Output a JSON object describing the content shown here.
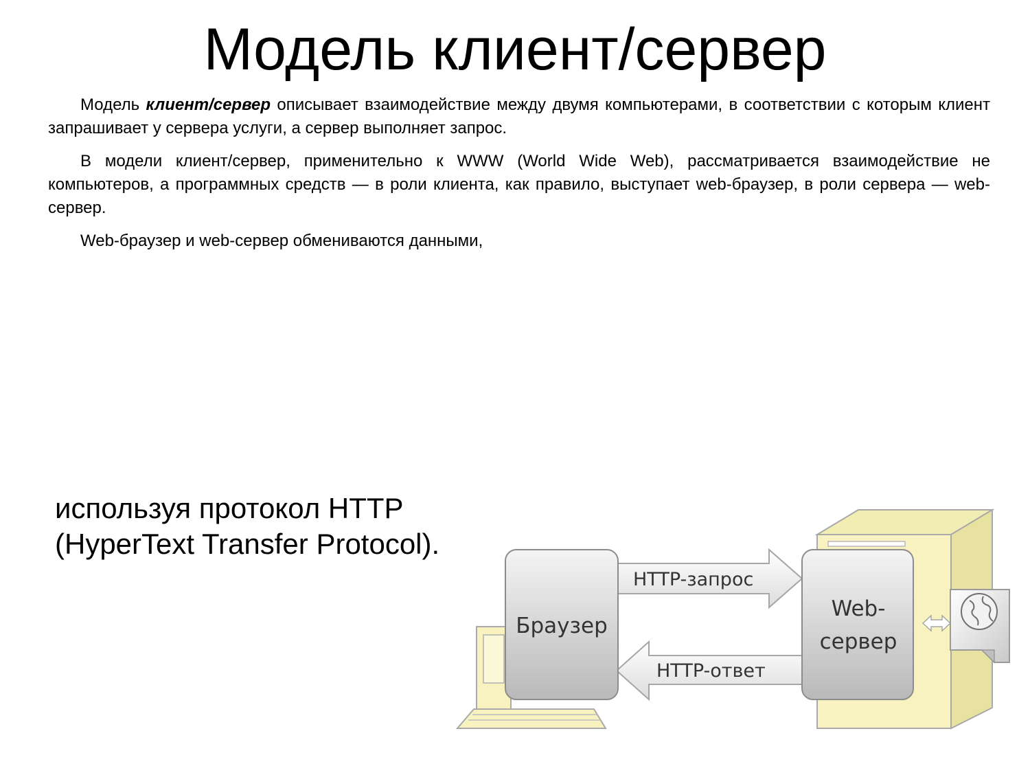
{
  "title": "Модель клиент/сервер",
  "paragraphs": {
    "p1_start": "Модель ",
    "p1_bold": "клиент/сервер",
    "p1_rest": " описывает взаимодействие между двумя компьютерами, в соответствии с которым клиент запрашивает у сервера услуги, а сервер выполняет запрос.",
    "p2": "В модели клиент/сервер, применительно к WWW (World Wide Web), рассматривается взаимодействие не компьютеров, а программных средств — в роли клиента, как правило, выступает web-браузер, в роли сервера — web-сервер.",
    "p3": "Web-браузер и web-сервер обмениваются данными,"
  },
  "protocol_text": "используя  протокол HTTP (HyperText Transfer Protocol).",
  "diagram": {
    "browser_label": "Браузер",
    "server_label_line1": "Web-",
    "server_label_line2": "сервер",
    "request_label": "HTTP-запрос",
    "response_label": "HTTP-ответ"
  }
}
